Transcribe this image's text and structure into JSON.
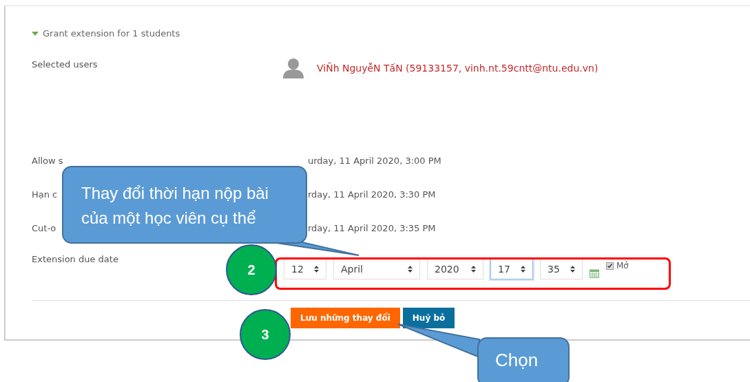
{
  "section": {
    "title": "Grant extension for 1 students",
    "expanded": true
  },
  "selected_users": {
    "label": "Selected users",
    "user": "ViÑh NguyễN TấN (59133157, vinh.nt.59cntt@ntu.edu.vn)"
  },
  "rows": [
    {
      "label": "Allow s",
      "value": "urday, 11 April 2020, 3:00 PM"
    },
    {
      "label": "Hạn c",
      "value": "rday, 11 April 2020, 3:30 PM"
    },
    {
      "label": "Cut-o",
      "value": "rday, 11 April 2020, 3:35 PM"
    }
  ],
  "extension": {
    "label": "Extension due date",
    "selects": [
      {
        "value": "12",
        "focused": false
      },
      {
        "value": "April",
        "focused": false
      },
      {
        "value": "2020",
        "focused": false
      },
      {
        "value": "17",
        "focused": true
      },
      {
        "value": "35",
        "focused": false
      }
    ],
    "enable": {
      "label": "Mở",
      "checked": true
    }
  },
  "buttons": [
    {
      "label": "Lưu những thay đổi",
      "kind": "primary"
    },
    {
      "label": "Huỷ bỏ",
      "kind": "secondary"
    }
  ],
  "annotations": {
    "callout_main": "Thay đổi thời hạn nộp bài của một học viên cụ thể",
    "step_2": "2",
    "step_3": "3",
    "callout_choose": "Chọn"
  }
}
